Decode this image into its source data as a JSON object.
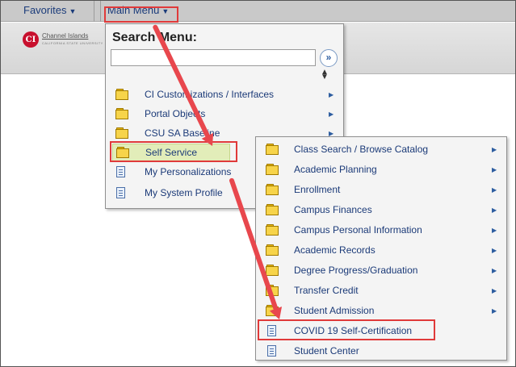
{
  "topbar": {
    "favorites": "Favorites",
    "main_menu": "Main Menu"
  },
  "logo": {
    "name": "Channel Islands",
    "subtext": "CALIFORNIA STATE UNIVERSITY",
    "mark": "CI",
    "icon": "channel-islands-logo"
  },
  "main_menu": {
    "search_title": "Search Menu:",
    "search_value": "",
    "go_icon": "double-chevron-right-icon",
    "sort_icon": "sort-icon",
    "items": [
      {
        "label": "CI Customizations / Interfaces",
        "icon": "folder-icon",
        "submenu": true
      },
      {
        "label": "Portal Objects",
        "icon": "folder-icon",
        "submenu": true
      },
      {
        "label": "CSU SA Baseline",
        "icon": "folder-icon",
        "submenu": true
      },
      {
        "label": "Self Service",
        "icon": "folder-icon",
        "submenu": true,
        "highlighted": true
      },
      {
        "label": "My Personalizations",
        "icon": "page-icon",
        "submenu": false
      },
      {
        "label": "My System Profile",
        "icon": "page-icon",
        "submenu": false
      }
    ]
  },
  "self_service_menu": {
    "items": [
      {
        "label": "Class Search / Browse Catalog",
        "icon": "folder-icon",
        "submenu": true
      },
      {
        "label": "Academic Planning",
        "icon": "folder-icon",
        "submenu": true
      },
      {
        "label": "Enrollment",
        "icon": "folder-icon",
        "submenu": true
      },
      {
        "label": "Campus Finances",
        "icon": "folder-icon",
        "submenu": true
      },
      {
        "label": "Campus Personal Information",
        "icon": "folder-icon",
        "submenu": true
      },
      {
        "label": "Academic Records",
        "icon": "folder-icon",
        "submenu": true
      },
      {
        "label": "Degree Progress/Graduation",
        "icon": "folder-icon",
        "submenu": true
      },
      {
        "label": "Transfer Credit",
        "icon": "folder-icon",
        "submenu": true
      },
      {
        "label": "Student Admission",
        "icon": "folder-icon",
        "submenu": true
      },
      {
        "label": "COVID 19 Self-Certification",
        "icon": "page-icon",
        "submenu": false,
        "target": true
      },
      {
        "label": "Student Center",
        "icon": "page-icon",
        "submenu": false
      }
    ]
  },
  "annotation_color": "#e8474d"
}
